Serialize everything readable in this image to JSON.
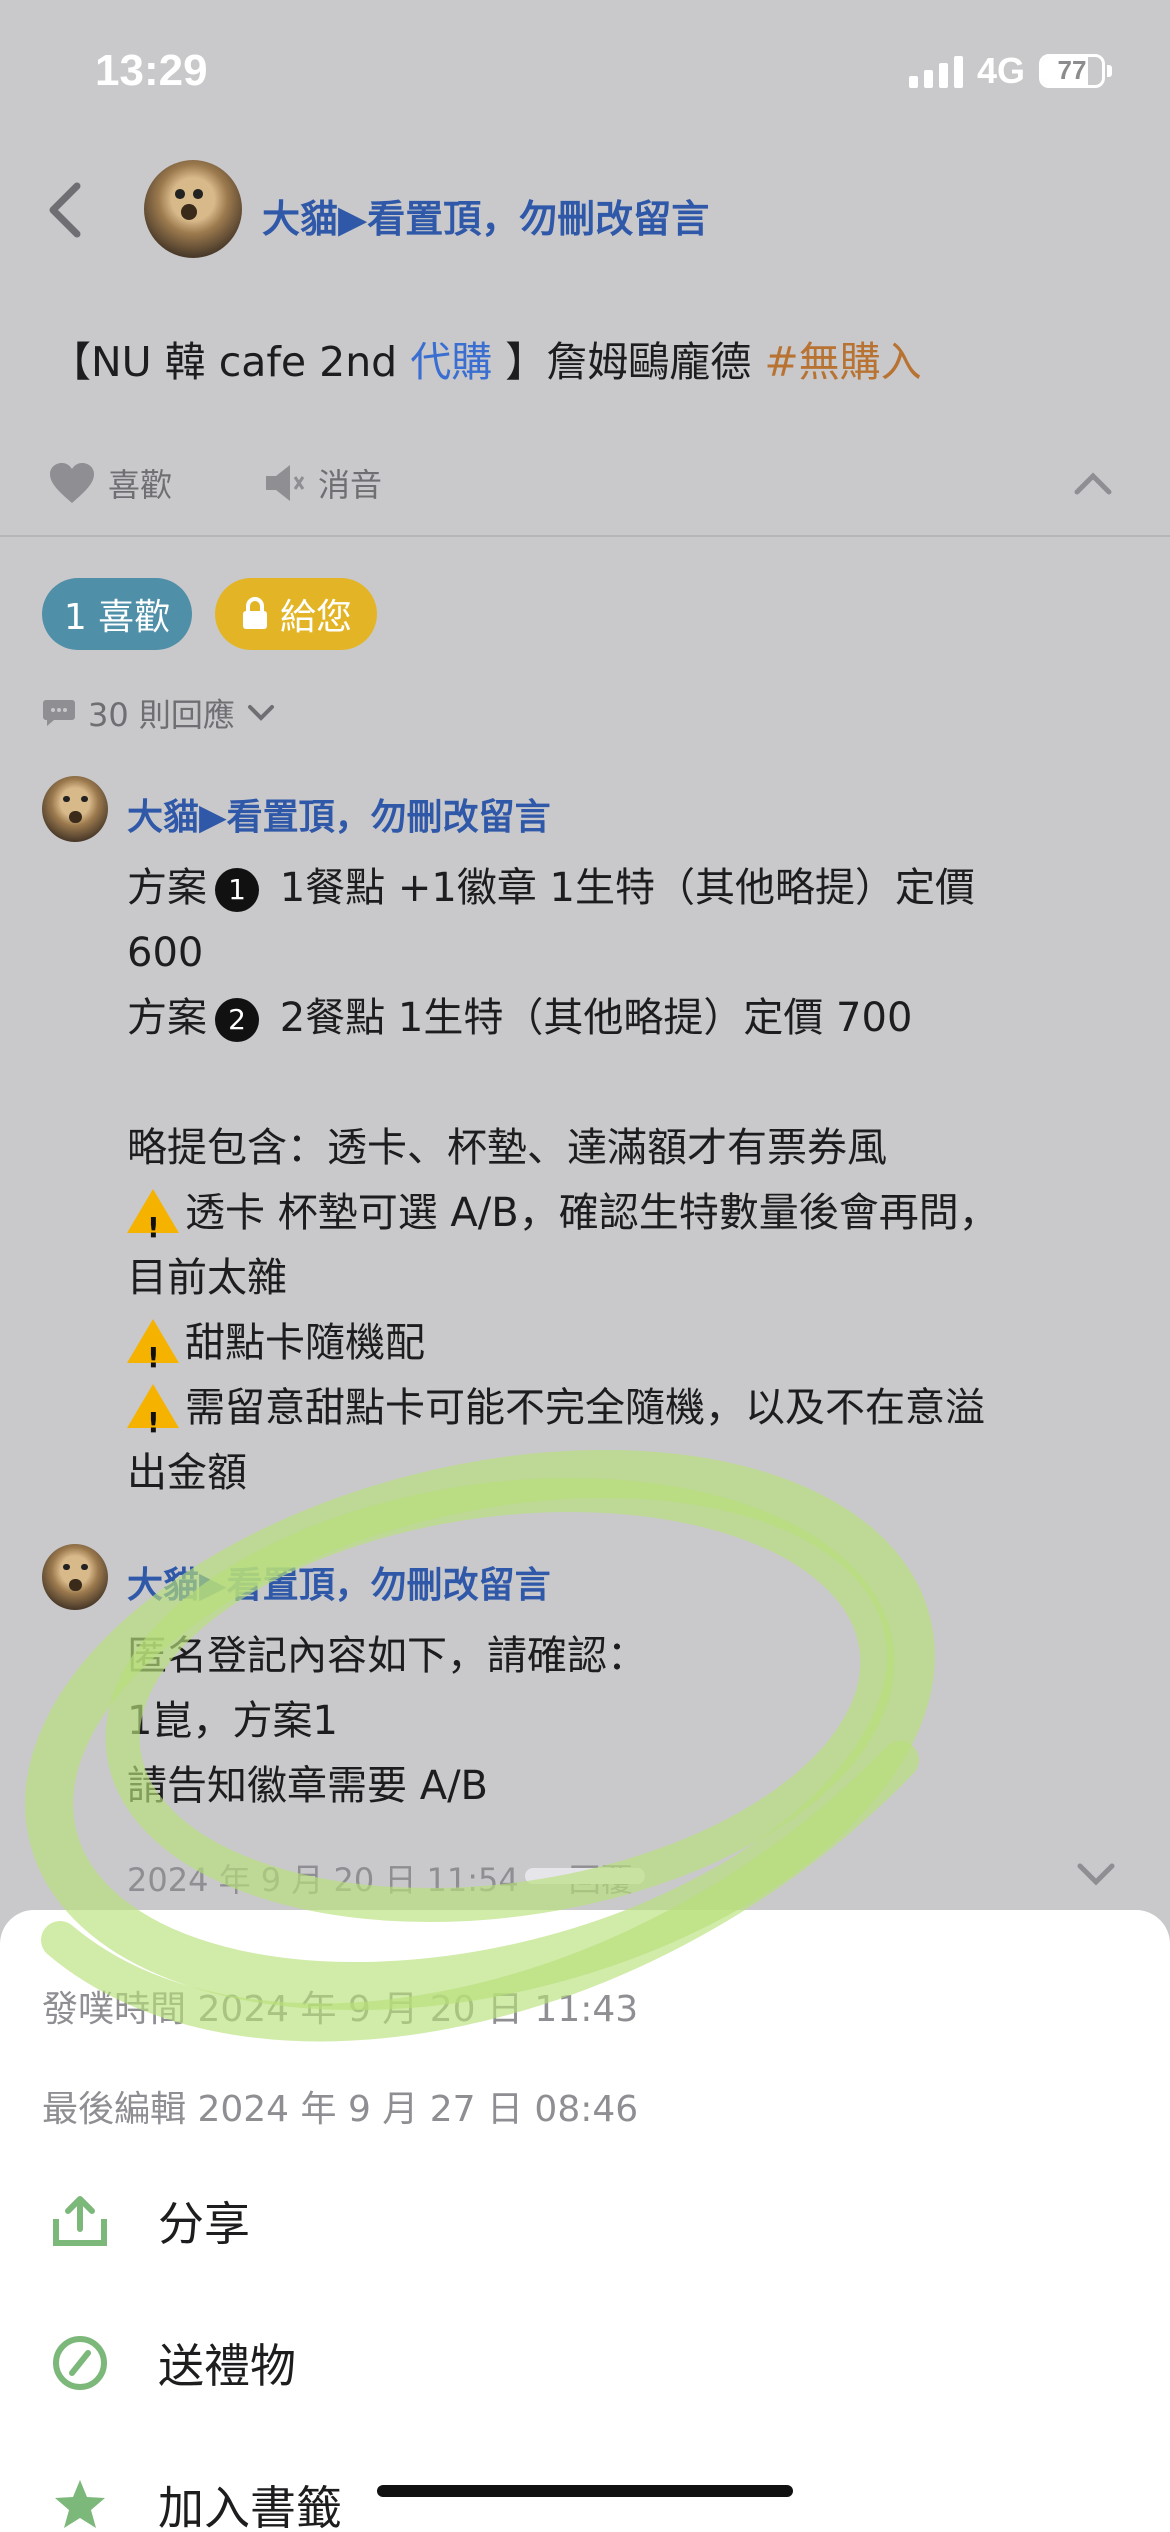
{
  "status_bar": {
    "time": "13:29",
    "network": "4G",
    "battery": "77",
    "battery_level": 0.77
  },
  "header": {
    "author_name": "大貓▶看置頂，勿刪改留言"
  },
  "post": {
    "title_prefix": "【NU 韓 cafe 2nd ",
    "title_link": "代購",
    "title_middle": " 】詹姆鷗龐德 ",
    "title_tag": "#無購入"
  },
  "actions": {
    "like": "喜歡",
    "mute": "消音"
  },
  "pills": {
    "likes": "1 喜歡",
    "gift": "給您"
  },
  "replies": {
    "count_label": "30 則回應"
  },
  "comments": [
    {
      "author": "大貓▶看置頂，勿刪改留言",
      "lines": [
        {
          "pre": "方案",
          "badge": "1",
          "post": " 1餐點 +1徽章 1生特（其他略提）定價"
        },
        {
          "pre": "600"
        },
        {
          "pre": "方案",
          "badge": "2",
          "post": " 2餐點 1生特（其他略提）定價 700"
        },
        {
          "pre": ""
        },
        {
          "pre": "略提包含：透卡、杯墊、達滿額才有票券風"
        },
        {
          "warn": true,
          "pre": "透卡 杯墊可選 A/B，確認生特數量後會再問，"
        },
        {
          "pre": "目前太雜"
        },
        {
          "warn": true,
          "pre": "甜點卡隨機配"
        },
        {
          "warn": true,
          "pre": "需留意甜點卡可能不完全隨機，以及不在意溢"
        },
        {
          "pre": "出金額"
        }
      ]
    },
    {
      "author": "大貓▶看置頂，勿刪改留言",
      "lines": [
        {
          "pre": "匿名登記內容如下，請確認："
        },
        {
          "pre": "1崑，方案1"
        },
        {
          "pre": "請告知徽章需要 A/B"
        }
      ],
      "timestamp": "2024 年 9 月 20 日 11:54",
      "reply_label": "回覆"
    }
  ],
  "sheet": {
    "posted": "發噗時間 2024 年 9 月 20 日 11:43",
    "edited": "最後編輯 2024 年 9 月 27 日 08:46",
    "items": [
      {
        "label": "分享",
        "icon": "share-icon"
      },
      {
        "label": "送禮物",
        "icon": "gift-icon"
      },
      {
        "label": "加入書籤",
        "icon": "star-icon"
      }
    ]
  },
  "colors": {
    "accent_blue": "#2f58a9",
    "link_blue": "#3a6fd1",
    "tag_orange": "#b87333",
    "pill_teal": "#4f8fa8",
    "pill_yellow": "#e3b526",
    "icon_green": "#7cb87a"
  }
}
